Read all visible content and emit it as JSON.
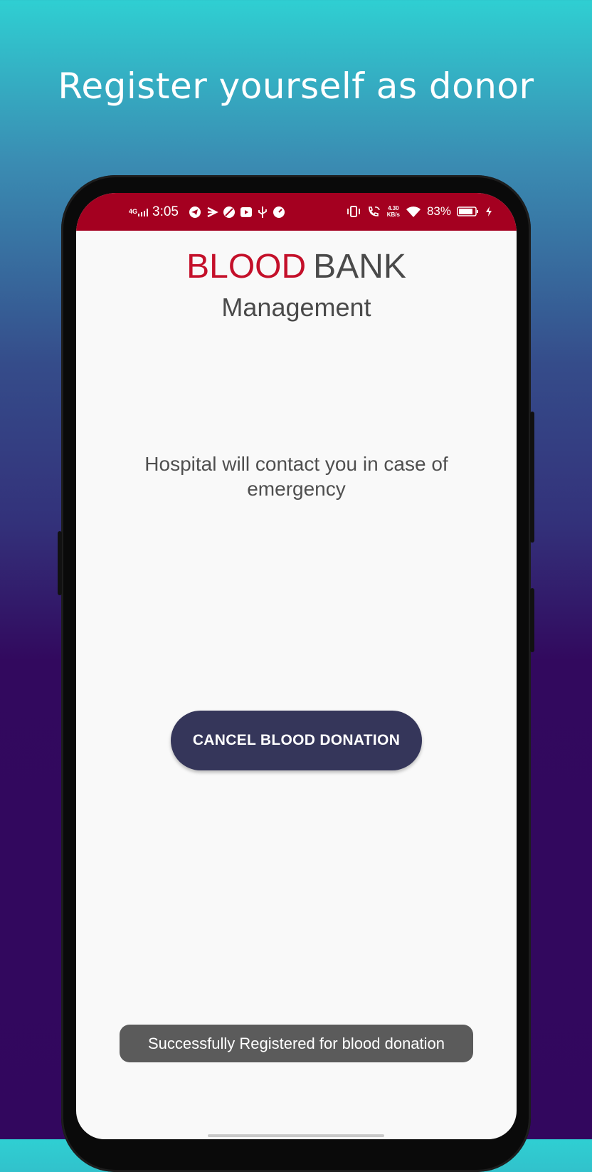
{
  "headline": "Register yourself as donor",
  "status_bar": {
    "network": "4G",
    "time": "3:05",
    "data_speed_top": "4.30",
    "data_speed_bottom": "KB/s",
    "battery": "83%"
  },
  "logo": {
    "blood": "BLOOD",
    "bank": "BANK",
    "subtitle": "Management"
  },
  "info_text": "Hospital will contact you in case of emergency",
  "cancel_button": "CANCEL BLOOD DONATION",
  "toast": "Successfully Registered for blood donation",
  "colors": {
    "accent": "#a40020",
    "logo_red": "#c4102a",
    "button": "#35365a",
    "toast": "#5b5b5b"
  }
}
